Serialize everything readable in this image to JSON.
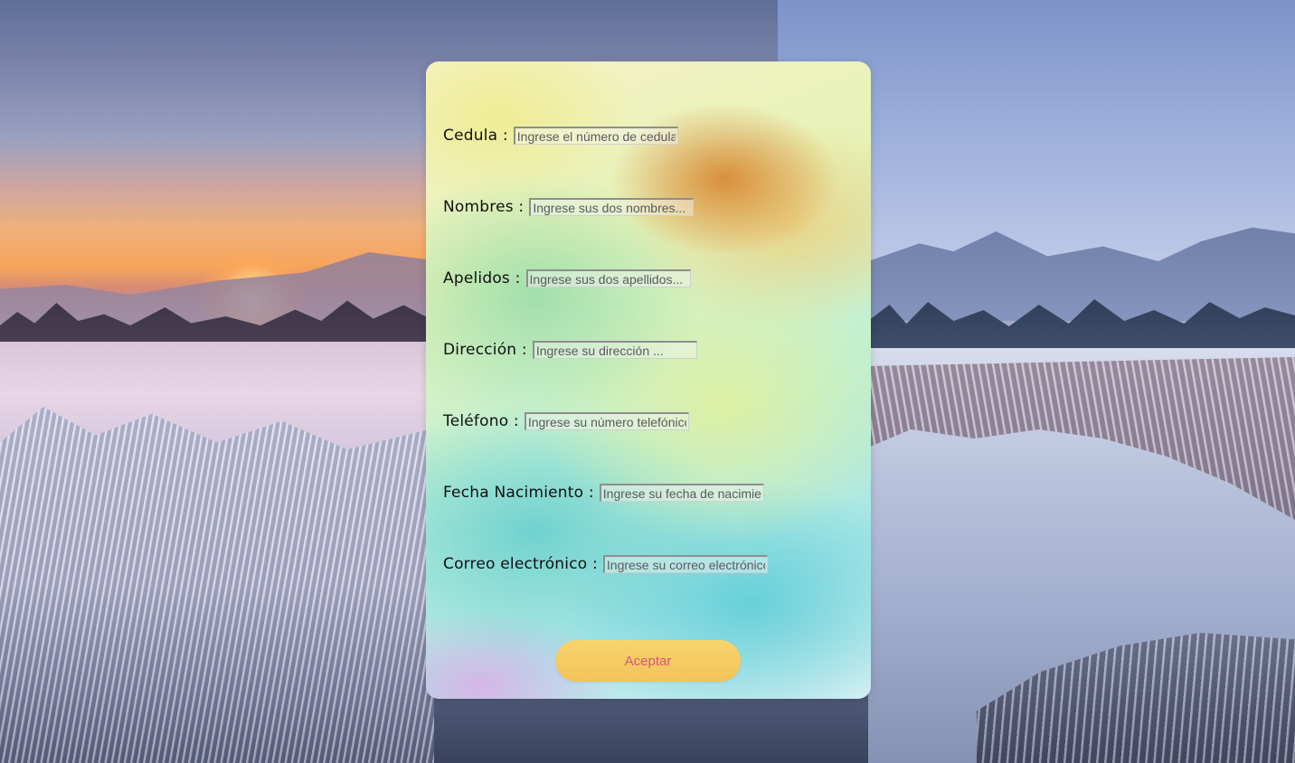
{
  "form": {
    "fields": [
      {
        "label": "Cedula :",
        "placeholder": "Ingrese el número de cedula"
      },
      {
        "label": "Nombres :",
        "placeholder": "Ingrese sus dos nombres..."
      },
      {
        "label": "Apelidos :",
        "placeholder": "Ingrese sus dos apellidos..."
      },
      {
        "label": "Dirección :",
        "placeholder": "Ingrese su dirección ..."
      },
      {
        "label": "Teléfono :",
        "placeholder": "Ingrese su número telefónico"
      },
      {
        "label": "Fecha Nacimiento :",
        "placeholder": "Ingrese su fecha de nacimiento"
      },
      {
        "label": "Correo electrónico :",
        "placeholder": "Ingrese su correo electrónico"
      }
    ],
    "submit_label": "Aceptar"
  },
  "colors": {
    "button_bg": "#f5cb60",
    "button_text": "#d9577a"
  }
}
